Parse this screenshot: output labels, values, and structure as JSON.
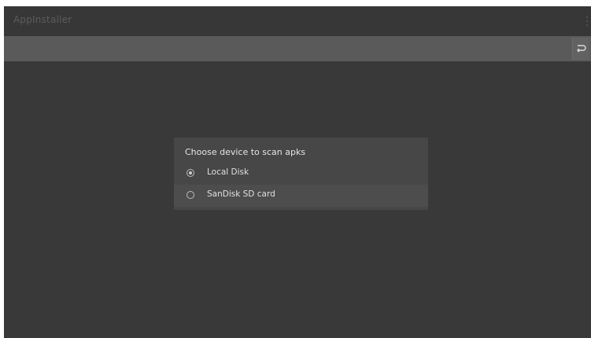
{
  "app": {
    "title": "AppInstaller"
  },
  "dialog": {
    "title": "Choose device to scan apks",
    "options": [
      {
        "label": "Local Disk",
        "selected": true
      },
      {
        "label": "SanDisk SD card",
        "selected": false
      }
    ]
  },
  "icons": {
    "menu": "more-vert-icon",
    "back": "return-arrow-icon",
    "radio_on": "radio-checked-icon",
    "radio_off": "radio-unchecked-icon"
  },
  "colors": {
    "background": "#393939",
    "dialog": "#474747",
    "path_bar": "#5a5a5a"
  }
}
